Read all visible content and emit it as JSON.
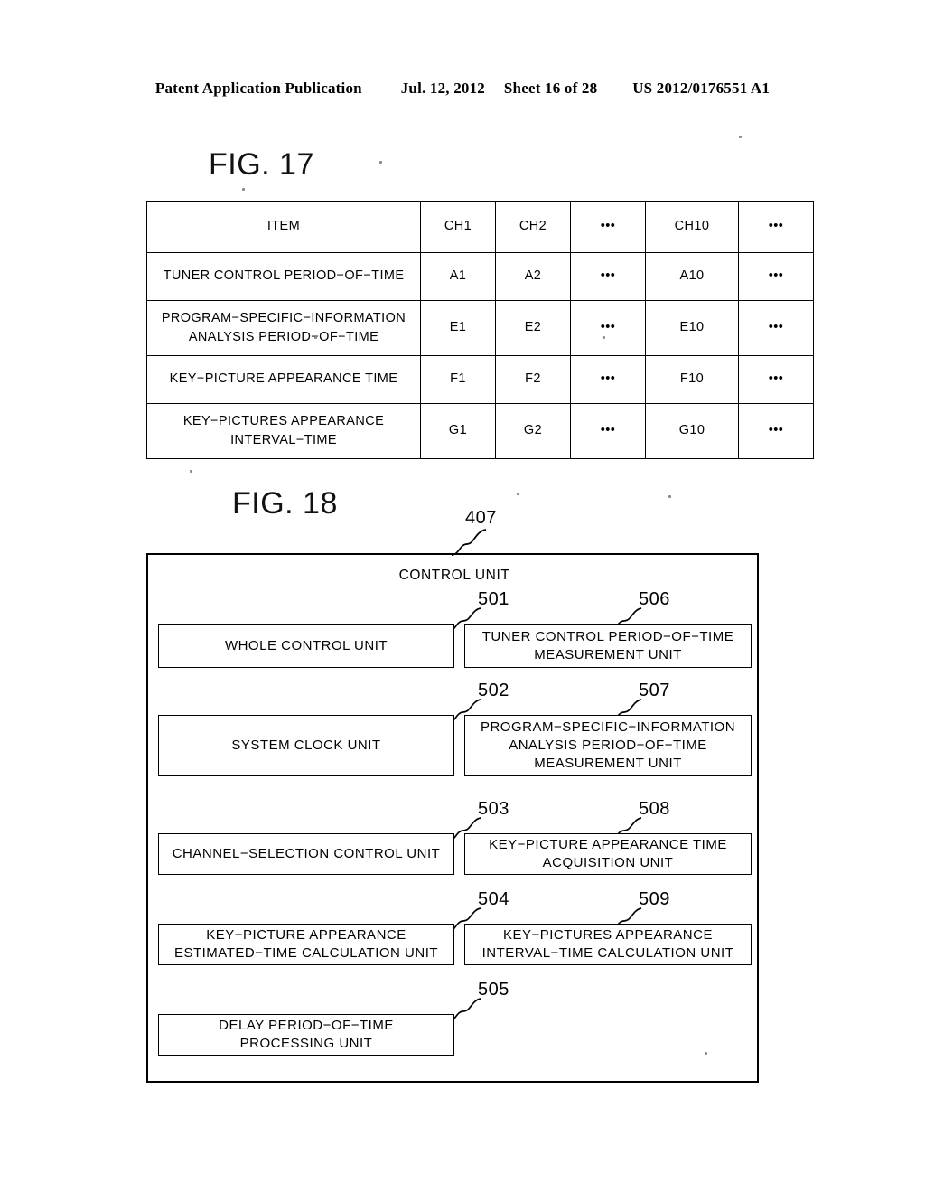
{
  "header": {
    "publication": "Patent Application Publication",
    "date": "Jul. 12, 2012",
    "sheet": "Sheet 16 of 28",
    "patent_number": "US 2012/0176551 A1"
  },
  "fig17": {
    "title": "FIG. 17",
    "columns": [
      "ITEM",
      "CH1",
      "CH2",
      "•••",
      "CH10",
      "•••"
    ],
    "rows": [
      {
        "item": "TUNER CONTROL PERIOD−OF−TIME",
        "ch1": "A1",
        "ch2": "A2",
        "mid_dots": "•••",
        "ch10": "A10",
        "tail_dots": "•••"
      },
      {
        "item": "PROGRAM−SPECIFIC−INFORMATION ANALYSIS PERIOD−OF−TIME",
        "item_line1": "PROGRAM−SPECIFIC−INFORMATION",
        "item_line2": "ANALYSIS PERIOD−OF−TIME",
        "ch1": "E1",
        "ch2": "E2",
        "mid_dots": "•••",
        "ch10": "E10",
        "tail_dots": "•••"
      },
      {
        "item": "KEY−PICTURE APPEARANCE TIME",
        "ch1": "F1",
        "ch2": "F2",
        "mid_dots": "•••",
        "ch10": "F10",
        "tail_dots": "•••"
      },
      {
        "item": "KEY−PICTURES APPEARANCE INTERVAL−TIME",
        "item_line1": "KEY−PICTURES APPEARANCE",
        "item_line2": "INTERVAL−TIME",
        "ch1": "G1",
        "ch2": "G2",
        "mid_dots": "•••",
        "ch10": "G10",
        "tail_dots": "•••"
      }
    ]
  },
  "fig18": {
    "title": "FIG. 18",
    "outer_ref": "407",
    "outer_label": "CONTROL UNIT",
    "units": [
      {
        "ref": "501",
        "label": "WHOLE CONTROL UNIT",
        "lines": [
          "WHOLE CONTROL UNIT"
        ]
      },
      {
        "ref": "502",
        "label": "SYSTEM CLOCK UNIT",
        "lines": [
          "SYSTEM CLOCK UNIT"
        ]
      },
      {
        "ref": "503",
        "label": "CHANNEL−SELECTION CONTROL UNIT",
        "lines": [
          "CHANNEL−SELECTION CONTROL UNIT"
        ]
      },
      {
        "ref": "504",
        "label": "KEY−PICTURE APPEARANCE ESTIMATED−TIME CALCULATION UNIT",
        "lines": [
          "KEY−PICTURE APPEARANCE",
          "ESTIMATED−TIME CALCULATION UNIT"
        ]
      },
      {
        "ref": "505",
        "label": "DELAY PERIOD−OF−TIME PROCESSING UNIT",
        "lines": [
          "DELAY PERIOD−OF−TIME",
          "PROCESSING UNIT"
        ]
      },
      {
        "ref": "506",
        "label": "TUNER CONTROL PERIOD−OF−TIME MEASUREMENT UNIT",
        "lines": [
          "TUNER CONTROL PERIOD−OF−TIME",
          "MEASUREMENT UNIT"
        ]
      },
      {
        "ref": "507",
        "label": "PROGRAM−SPECIFIC−INFORMATION ANALYSIS PERIOD−OF−TIME MEASUREMENT UNIT",
        "lines": [
          "PROGRAM−SPECIFIC−INFORMATION",
          "ANALYSIS PERIOD−OF−TIME",
          "MEASUREMENT UNIT"
        ]
      },
      {
        "ref": "508",
        "label": "KEY−PICTURE APPEARANCE TIME ACQUISITION UNIT",
        "lines": [
          "KEY−PICTURE APPEARANCE TIME",
          "ACQUISITION UNIT"
        ]
      },
      {
        "ref": "509",
        "label": "KEY−PICTURES APPEARANCE INTERVAL−TIME CALCULATION UNIT",
        "lines": [
          "KEY−PICTURES APPEARANCE",
          "INTERVAL−TIME CALCULATION UNIT"
        ]
      }
    ]
  },
  "colors": {
    "ink": "#000000",
    "paper": "#ffffff"
  }
}
